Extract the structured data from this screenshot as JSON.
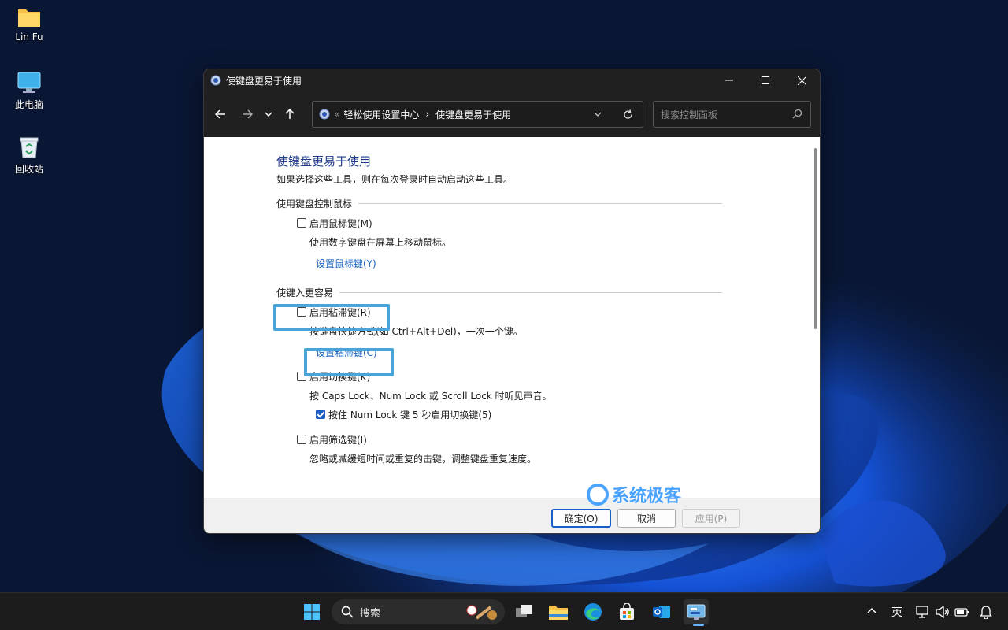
{
  "desktop": {
    "icons": [
      {
        "label": "Lin Fu"
      },
      {
        "label": "此电脑"
      },
      {
        "label": "回收站"
      }
    ]
  },
  "window": {
    "title": "使键盘更易于使用",
    "address": {
      "prefix": "«",
      "crumb1": "轻松使用设置中心",
      "separator": "›",
      "crumb2": "使键盘更易于使用"
    },
    "search_placeholder": "搜索控制面板",
    "content": {
      "heading": "使键盘更易于使用",
      "description": "如果选择这些工具，则在每次登录时自动启动这些工具。",
      "section1": {
        "title": "使用键盘控制鼠标",
        "mouse_keys_label": "启用鼠标键(M)",
        "mouse_keys_desc": "使用数字键盘在屏幕上移动鼠标。",
        "mouse_keys_link": "设置鼠标键(Y)"
      },
      "section2": {
        "title": "使键入更容易",
        "sticky_keys_label": "启用粘滞键(R)",
        "sticky_keys_desc": "按键盘快捷方式(如 Ctrl+Alt+Del)，一次一个键。",
        "sticky_keys_link": "设置粘滞键(C)",
        "toggle_keys_label": "启用切换键(K)",
        "toggle_keys_desc": "按 Caps Lock、Num Lock 或 Scroll Lock 时听见声音。",
        "toggle_numlock_label": "按住 Num Lock 键 5 秒启用切换键(5)",
        "filter_keys_label": "启用筛选键(I)",
        "filter_keys_desc": "忽略或减缓短时间或重复的击键，调整键盘重复速度。"
      }
    },
    "buttons": {
      "ok": "确定(O)",
      "cancel": "取消",
      "apply": "应用(P)"
    }
  },
  "watermark": "系统极客",
  "taskbar": {
    "search_label": "搜索",
    "ime": "英"
  }
}
